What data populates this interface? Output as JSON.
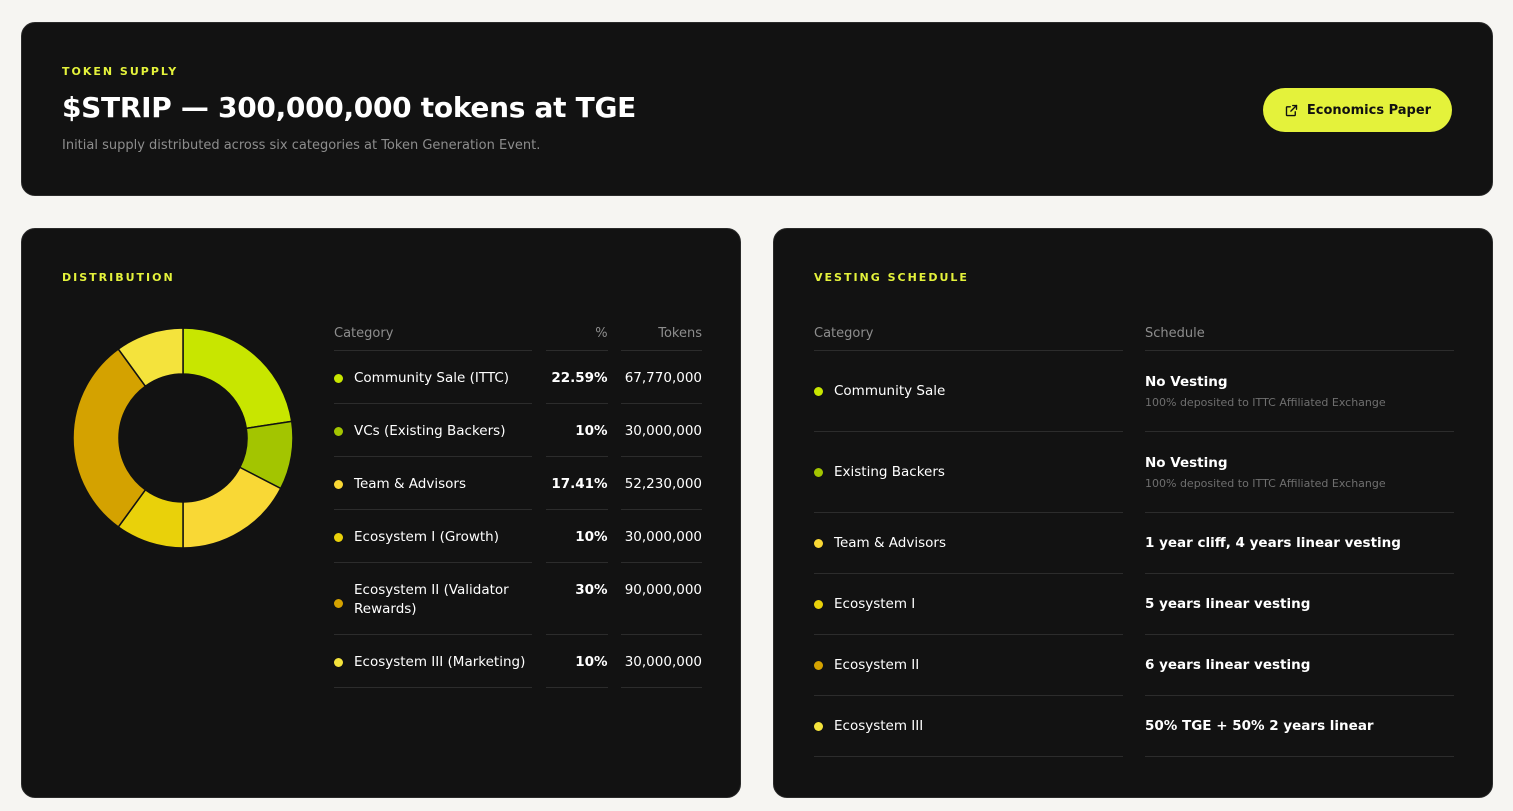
{
  "header": {
    "eyebrow": "TOKEN SUPPLY",
    "title": "$STRIP — 300,000,000 tokens at TGE",
    "subtitle": "Initial supply distributed across six categories at Token Generation Event.",
    "cta_label": "Economics Paper",
    "cta_icon": "external-link-icon"
  },
  "colors": {
    "accent": "#e4f23b",
    "card_bg": "#121212",
    "page_bg": "#f6f5f2"
  },
  "distribution": {
    "eyebrow": "DISTRIBUTION",
    "headers": {
      "category": "Category",
      "percent": "%",
      "tokens": "Tokens"
    },
    "rows": [
      {
        "category": "Community Sale (ITTC)",
        "percent": "22.59%",
        "tokens": "67,770,000",
        "color": "#c8e600",
        "value": 22.59
      },
      {
        "category": "VCs (Existing Backers)",
        "percent": "10%",
        "tokens": "30,000,000",
        "color": "#a3c500",
        "value": 10
      },
      {
        "category": "Team & Advisors",
        "percent": "17.41%",
        "tokens": "52,230,000",
        "color": "#f9d835",
        "value": 17.41
      },
      {
        "category": "Ecosystem I (Growth)",
        "percent": "10%",
        "tokens": "30,000,000",
        "color": "#e9d10a",
        "value": 10
      },
      {
        "category": "Ecosystem II (Validator Rewards)",
        "percent": "30%",
        "tokens": "90,000,000",
        "color": "#d4a200",
        "value": 30
      },
      {
        "category": "Ecosystem III (Marketing)",
        "percent": "10%",
        "tokens": "30,000,000",
        "color": "#f4e33c",
        "value": 10
      }
    ]
  },
  "vesting": {
    "eyebrow": "VESTING SCHEDULE",
    "headers": {
      "category": "Category",
      "schedule": "Schedule"
    },
    "rows": [
      {
        "category": "Community Sale",
        "schedule": "No Vesting",
        "note": "100% deposited to ITTC Affiliated Exchange",
        "color": "#c8e600"
      },
      {
        "category": "Existing Backers",
        "schedule": "No Vesting",
        "note": "100% deposited to ITTC Affiliated Exchange",
        "color": "#a3c500"
      },
      {
        "category": "Team & Advisors",
        "schedule": "1 year cliff, 4 years linear vesting",
        "note": "",
        "color": "#f9d835"
      },
      {
        "category": "Ecosystem I",
        "schedule": "5 years linear vesting",
        "note": "",
        "color": "#e9d10a"
      },
      {
        "category": "Ecosystem II",
        "schedule": "6 years linear vesting",
        "note": "",
        "color": "#d4a200"
      },
      {
        "category": "Ecosystem III",
        "schedule": "50% TGE + 50% 2 years linear",
        "note": "",
        "color": "#f4e33c"
      }
    ]
  }
}
